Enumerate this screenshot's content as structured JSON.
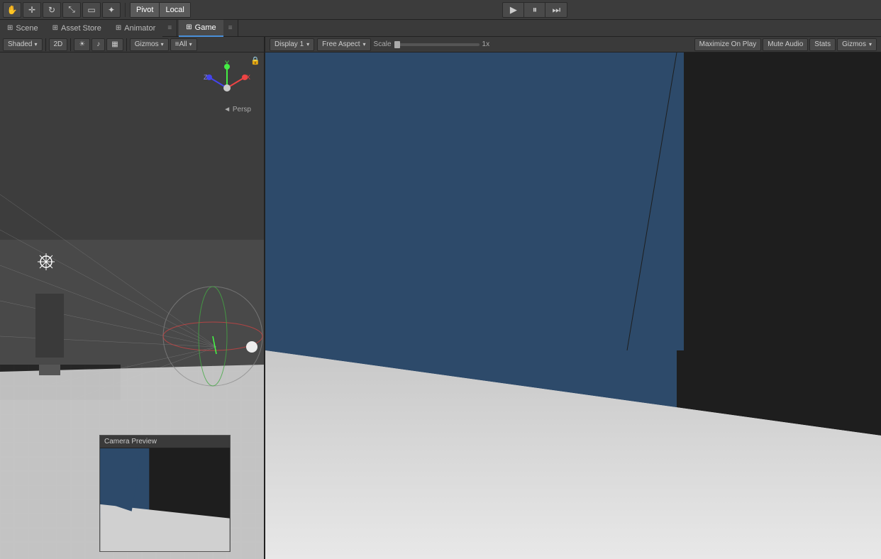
{
  "topToolbar": {
    "transformTools": [
      "hand",
      "move",
      "rotate",
      "scale",
      "rect",
      "multi"
    ],
    "pivotMode": "Pivot",
    "localMode": "Local",
    "playBtn": "▶",
    "pauseBtn": "⏸",
    "stepBtn": "⏭"
  },
  "tabs": {
    "left": [
      {
        "label": "Scene",
        "icon": "⊞",
        "active": false
      },
      {
        "label": "Asset Store",
        "icon": "⊞",
        "active": false
      },
      {
        "label": "Animator",
        "icon": "⊞",
        "active": false
      }
    ],
    "right": [
      {
        "label": "Game",
        "icon": "⊞",
        "active": true
      }
    ]
  },
  "sceneToolbar": {
    "shading": "Shaded",
    "mode2D": "2D",
    "lightingBtn": "☀",
    "audioBtn": "♪",
    "effectsBtn": "▦",
    "gizmosBtn": "Gizmos",
    "allBtn": "≡All"
  },
  "gameToolbar": {
    "displayLabel": "Display 1",
    "aspectLabel": "Free Aspect",
    "scaleLabel": "Scale",
    "scaleValue": "1x",
    "maximizeOnPlay": "Maximize On Play",
    "muteAudio": "Mute Audio",
    "stats": "Stats",
    "gizmos": "Gizmos"
  },
  "sceneView": {
    "perspLabel": "◄ Persp",
    "lockIcon": "🔒"
  },
  "cameraPreview": {
    "title": "Camera Preview"
  }
}
